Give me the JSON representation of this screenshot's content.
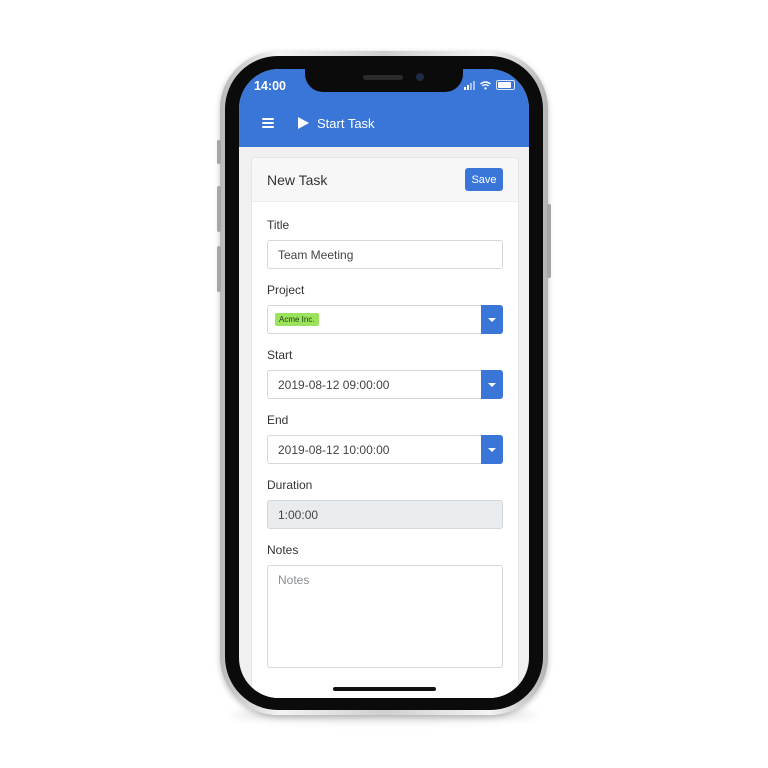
{
  "status_bar": {
    "time": "14:00"
  },
  "header": {
    "title": "Start Task"
  },
  "form": {
    "card_title": "New Task",
    "save_label": "Save",
    "title_label": "Title",
    "title_value": "Team Meeting",
    "project_label": "Project",
    "project_tag": "Acme Inc.",
    "start_label": "Start",
    "start_value": "2019-08-12 09:00:00",
    "end_label": "End",
    "end_value": "2019-08-12 10:00:00",
    "duration_label": "Duration",
    "duration_value": "1:00:00",
    "notes_label": "Notes",
    "notes_placeholder": "Notes"
  },
  "colors": {
    "accent": "#3a76d8",
    "tag": "#9be35c"
  }
}
